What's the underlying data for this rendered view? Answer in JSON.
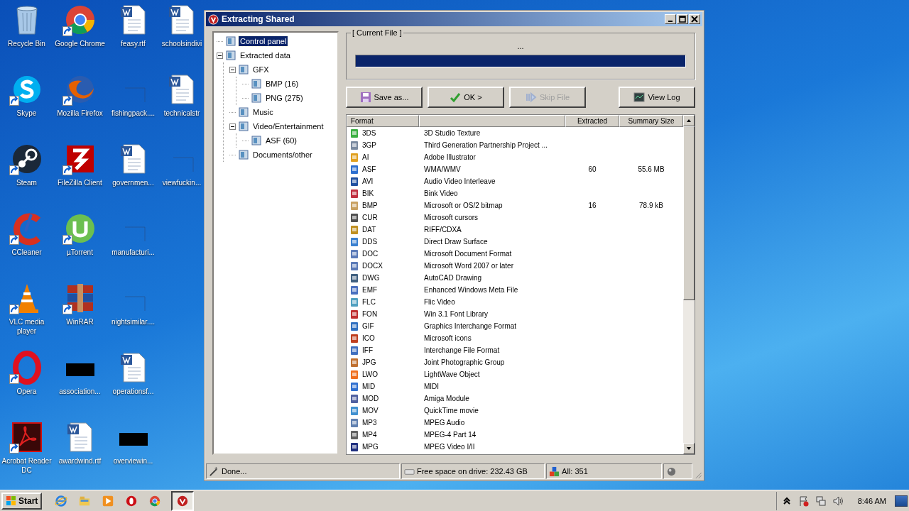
{
  "desktop": {
    "icons": [
      {
        "kind": "recycle",
        "label": "Recycle Bin",
        "shortcut": false
      },
      {
        "kind": "skype",
        "label": "Skype",
        "shortcut": true
      },
      {
        "kind": "steam",
        "label": "Steam",
        "shortcut": true
      },
      {
        "kind": "ccleaner",
        "label": "CCleaner",
        "shortcut": true
      },
      {
        "kind": "vlc",
        "label": "VLC media player",
        "shortcut": true
      },
      {
        "kind": "opera",
        "label": "Opera",
        "shortcut": true
      },
      {
        "kind": "acrobat",
        "label": "Acrobat Reader DC",
        "shortcut": true
      },
      {
        "kind": "chrome",
        "label": "Google Chrome",
        "shortcut": true
      },
      {
        "kind": "firefox",
        "label": "Mozilla Firefox",
        "shortcut": true
      },
      {
        "kind": "filezilla",
        "label": "FileZilla Client",
        "shortcut": true
      },
      {
        "kind": "utorrent",
        "label": "µTorrent",
        "shortcut": true
      },
      {
        "kind": "winrar",
        "label": "WinRAR",
        "shortcut": true
      },
      {
        "kind": "redacted",
        "label": "association...",
        "shortcut": false
      },
      {
        "kind": "doc",
        "label": "awardwind.rtf",
        "shortcut": false
      },
      {
        "kind": "doc",
        "label": "feasy.rtf",
        "shortcut": false
      },
      {
        "kind": "blank",
        "label": "fishingpack....",
        "shortcut": false
      },
      {
        "kind": "doc",
        "label": "governmen...",
        "shortcut": false
      },
      {
        "kind": "blank",
        "label": "manufacturi...",
        "shortcut": false
      },
      {
        "kind": "blank",
        "label": "nightsimilar....",
        "shortcut": false
      },
      {
        "kind": "doc",
        "label": "operationsf...",
        "shortcut": false
      },
      {
        "kind": "redacted",
        "label": "overviewin...",
        "shortcut": false
      },
      {
        "kind": "doc",
        "label": "schoolsindivi",
        "shortcut": false
      },
      {
        "kind": "doc",
        "label": "technicalstr",
        "shortcut": false
      },
      {
        "kind": "blank",
        "label": "viewfuckin...",
        "shortcut": false
      }
    ]
  },
  "window": {
    "title": "Extracting Shared",
    "tree": [
      {
        "label": "Control panel",
        "selected": true
      },
      {
        "label": "Extracted data",
        "selected": false,
        "expanded": true,
        "children": [
          {
            "label": "GFX",
            "selected": false,
            "expanded": true,
            "children": [
              {
                "label": "BMP (16)",
                "selected": false
              },
              {
                "label": "PNG (275)",
                "selected": false
              }
            ]
          },
          {
            "label": "Music",
            "selected": false
          },
          {
            "label": "Video/Entertainment",
            "selected": false,
            "expanded": true,
            "children": [
              {
                "label": "ASF (60)",
                "selected": false
              }
            ]
          },
          {
            "label": "Documents/other",
            "selected": false
          }
        ]
      }
    ],
    "current_file": {
      "legend": "[ Current File ]",
      "name": "...",
      "level": 1
    },
    "buttons": [
      {
        "kind": "save",
        "label": "Save as...",
        "disabled": false
      },
      {
        "kind": "ok",
        "label": "OK >",
        "disabled": false
      },
      {
        "kind": "skip",
        "label": "Skip File",
        "disabled": true
      },
      {
        "kind": "log",
        "label": "View Log",
        "disabled": false
      }
    ],
    "table": {
      "columns": {
        "format": "Format",
        "extracted": "Extracted",
        "summary_size": "Summary Size"
      },
      "rows": [
        {
          "format": "3DS",
          "description": "3D Studio Texture"
        },
        {
          "format": "3GP",
          "description": "Third Generation Partnership Project ..."
        },
        {
          "format": "AI",
          "description": "Adobe Illustrator"
        },
        {
          "format": "ASF",
          "description": "WMA/WMV",
          "extracted": "60",
          "size": "55.6 MB"
        },
        {
          "format": "AVI",
          "description": "Audio Video Interleave"
        },
        {
          "format": "BIK",
          "description": "Bink Video"
        },
        {
          "format": "BMP",
          "description": "Microsoft or OS/2 bitmap",
          "extracted": "16",
          "size": "78.9 kB"
        },
        {
          "format": "CUR",
          "description": "Microsoft cursors"
        },
        {
          "format": "DAT",
          "description": "RIFF/CDXA"
        },
        {
          "format": "DDS",
          "description": "Direct Draw Surface"
        },
        {
          "format": "DOC",
          "description": "Microsoft Document Format"
        },
        {
          "format": "DOCX",
          "description": "Microsoft Word 2007 or later"
        },
        {
          "format": "DWG",
          "description": "AutoCAD Drawing"
        },
        {
          "format": "EMF",
          "description": "Enhanced Windows Meta File"
        },
        {
          "format": "FLC",
          "description": "Flic Video"
        },
        {
          "format": "FON",
          "description": "Win 3.1 Font Library"
        },
        {
          "format": "GIF",
          "description": "Graphics Interchange Format"
        },
        {
          "format": "ICO",
          "description": "Microsoft icons"
        },
        {
          "format": "IFF",
          "description": "Interchange File Format"
        },
        {
          "format": "JPG",
          "description": "Joint Photographic Group"
        },
        {
          "format": "LWO",
          "description": "LightWave Object"
        },
        {
          "format": "MID",
          "description": "MIDI"
        },
        {
          "format": "MOD",
          "description": "Amiga Module"
        },
        {
          "format": "MOV",
          "description": "QuickTime movie"
        },
        {
          "format": "MP3",
          "description": "MPEG Audio"
        },
        {
          "format": "MP4",
          "description": "MPEG-4 Part 14"
        },
        {
          "format": "MPG",
          "description": "MPEG Video I/II"
        }
      ]
    },
    "status_bar": {
      "status": "Done...",
      "free_space": "Free space on drive: 232.43 GB",
      "count": "All: 351"
    }
  },
  "taskbar": {
    "start": "Start",
    "apps": [
      {
        "kind": "ie",
        "selected": false
      },
      {
        "kind": "explorer",
        "selected": false
      },
      {
        "kind": "media",
        "selected": false
      },
      {
        "kind": "opera",
        "selected": false
      },
      {
        "kind": "chrome",
        "selected": false
      },
      {
        "kind": "extractor",
        "selected": true
      }
    ],
    "clock": "8:46 AM"
  }
}
